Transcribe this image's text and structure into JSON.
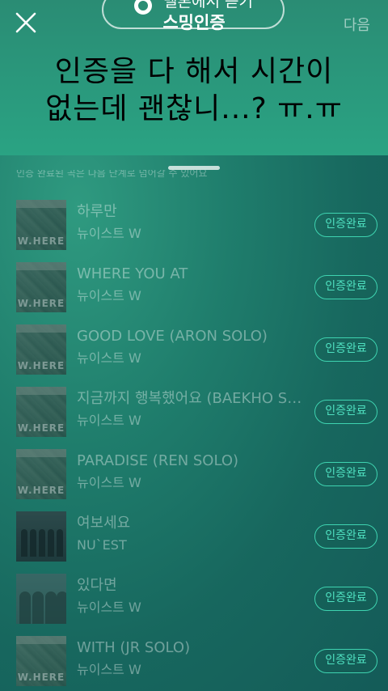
{
  "header": {
    "title": "스밍인증",
    "listen_button": "멜론에서 듣기",
    "next_button": "다음",
    "overlay_message_line1": "인증을 다 해서 시간이",
    "overlay_message_line2": "없는데 괜찮니...? ㅠ.ㅠ"
  },
  "sheet": {
    "hint": "인증 완료된 곡은 다음 단계로 넘어갈 수 있어요"
  },
  "songs": [
    {
      "title": "하루만",
      "artist": "뉴이스트 W",
      "status": "인증완료",
      "art": "where"
    },
    {
      "title": "WHERE YOU AT",
      "artist": "뉴이스트 W",
      "status": "인증완료",
      "art": "where"
    },
    {
      "title": "GOOD LOVE (ARON SOLO)",
      "artist": "뉴이스트 W",
      "status": "인증완료",
      "art": "where"
    },
    {
      "title": "지금까지 행복했어요 (BAEKHO SOLO)",
      "artist": "뉴이스트 W",
      "status": "인증완료",
      "art": "where"
    },
    {
      "title": "PARADISE (REN SOLO)",
      "artist": "뉴이스트 W",
      "status": "인증완료",
      "art": "where"
    },
    {
      "title": "여보세요",
      "artist": "NU`EST",
      "status": "인증완료",
      "art": "band"
    },
    {
      "title": "있다면",
      "artist": "뉴이스트 W",
      "status": "인증완료",
      "art": "group"
    },
    {
      "title": "WITH (JR SOLO)",
      "artist": "뉴이스트 W",
      "status": "인증완료",
      "art": "where"
    }
  ],
  "colors": {
    "accent": "#3ed3b0",
    "header_bg": "#2aa383",
    "body_bg": "#17675e"
  }
}
